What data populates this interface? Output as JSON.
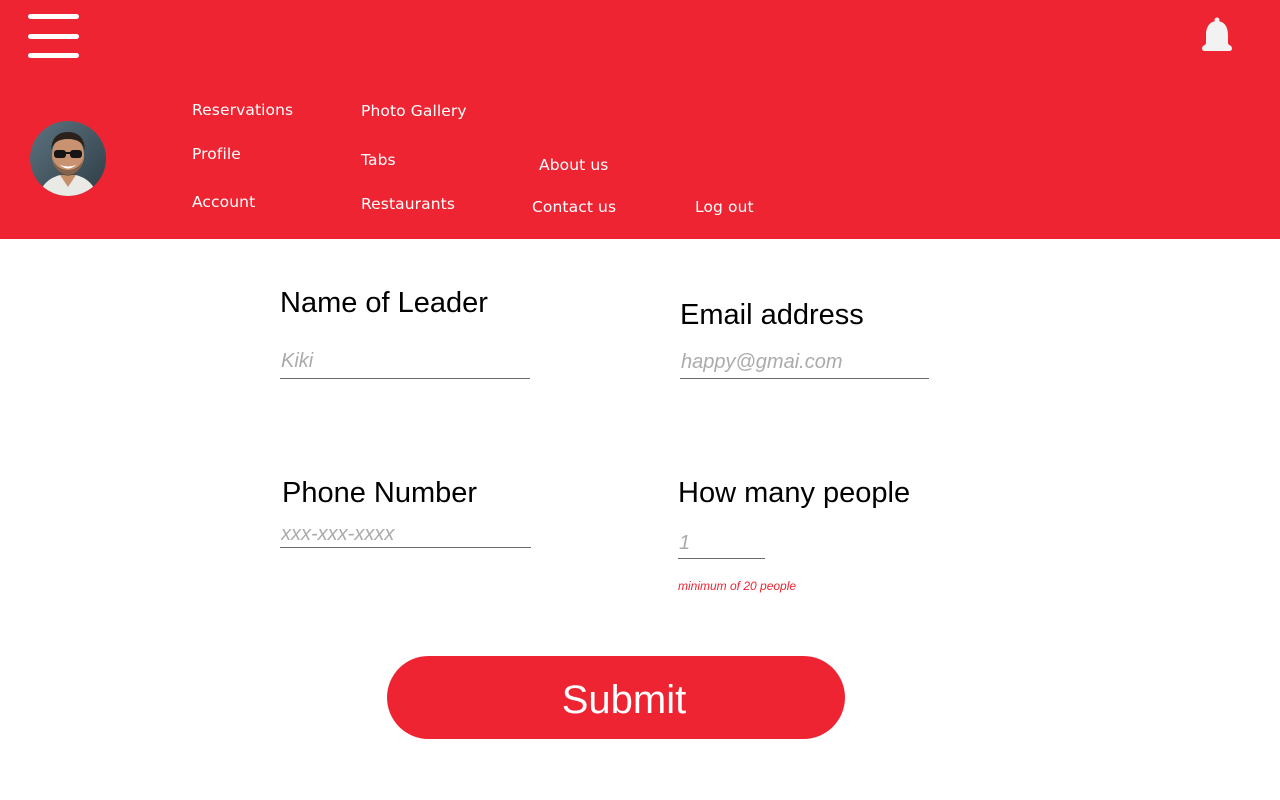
{
  "header": {
    "brand_color": "#ee2432",
    "menu_icon": "hamburger-menu-icon",
    "notification_icon": "bell-icon",
    "avatar_icon": "user-avatar-photo"
  },
  "nav": {
    "reservations": "Reservations",
    "profile": "Profile",
    "account": "Account",
    "photo_gallery": "Photo Gallery",
    "tabs": "Tabs",
    "restaurants": "Restaurants",
    "about_us": "About us",
    "contact_us": "Contact us",
    "log_out": "Log out"
  },
  "form": {
    "leader_name": {
      "label": "Name of Leader",
      "placeholder": "Kiki"
    },
    "email": {
      "label": "Email address",
      "placeholder": "happy@gmai.com"
    },
    "phone": {
      "label": "Phone Number",
      "placeholder": "xxx-xxx-xxxx"
    },
    "people": {
      "label": "How many people",
      "placeholder": "1",
      "hint": "minimum of 20 people"
    },
    "submit_label": "Submit"
  }
}
